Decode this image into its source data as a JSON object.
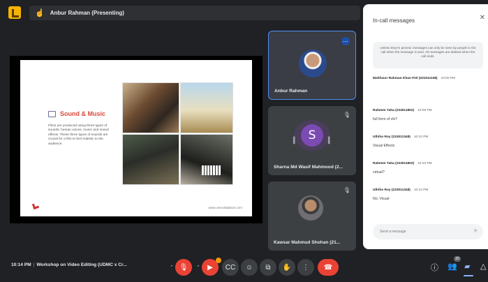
{
  "topbar": {
    "presenter_label": "Anbur Rahman (Presenting)"
  },
  "slide": {
    "title": "Sound & Music",
    "body": "Films are produced using three types of sounds: human voices, music and sound effects. These three types of sounds are crucial for a film to feel realistic to the audience.",
    "footer": "www.unecobalance.com"
  },
  "participants": [
    {
      "name": "Anbur Rahman",
      "status_icon": "more-options-icon"
    },
    {
      "name": "Sharna Md Wasif Mahmood (2...",
      "initial": "S",
      "status_icon": "mic-off-icon"
    },
    {
      "name": "Kawsar Mahmud Shohan (21...",
      "status_icon": "mic-off-icon"
    }
  ],
  "chat": {
    "title": "In-call messages",
    "notice": "Unless they're pinned, messages can only be seen by people in the call when the message is sent. All messages are deleted when the call ends.",
    "messages": [
      {
        "author": "Mahfuzur Rahman Khan Fiel (201011108)",
        "time": "10:00 PM",
        "text": ""
      },
      {
        "author": "Raheem Taha (233011802)",
        "time": "10:09 PM",
        "text": "full form of vfx?"
      },
      {
        "author": "Uthiho Roy (233011348)",
        "time": "10:10 PM",
        "text": "Visual Effects"
      },
      {
        "author": "Raheem Taha (233011802)",
        "time": "10:10 PM",
        "text": "virtual?"
      },
      {
        "author": "Uthiho Roy (233011348)",
        "time": "10:10 PM",
        "text": "No, Visual"
      }
    ],
    "input_placeholder": "Send a message"
  },
  "bottombar": {
    "time": "10:14 PM",
    "separator": "|",
    "meeting_title": "Workshop on Video Editing (UDMC x Cr...",
    "people_count": "20"
  },
  "colors": {
    "accent": "#8ab4f8",
    "danger": "#ea4335",
    "background": "#202124"
  }
}
